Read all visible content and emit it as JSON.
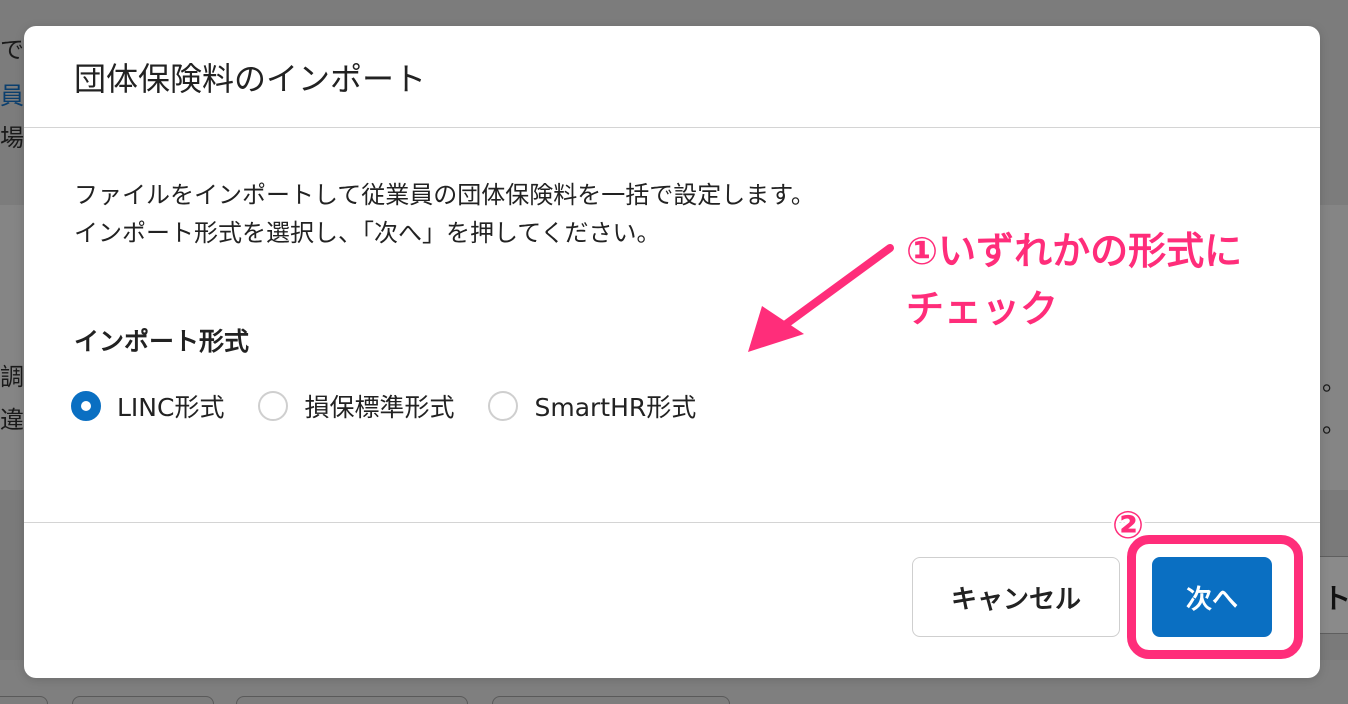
{
  "background": {
    "chars": [
      "で",
      "員",
      "場",
      "調",
      "違",
      "。",
      "。"
    ],
    "right_button_label": "ト"
  },
  "modal": {
    "title": "団体保険料のインポート",
    "description_line1": "ファイルをインポートして従業員の団体保険料を一括で設定します。",
    "description_line2": "インポート形式を選択し、「次へ」を押してください。",
    "section_label": "インポート形式",
    "radio_options": [
      {
        "label": "LINC形式",
        "checked": true
      },
      {
        "label": "損保標準形式",
        "checked": false
      },
      {
        "label": "SmartHR形式",
        "checked": false
      }
    ],
    "cancel_label": "キャンセル",
    "next_label": "次へ"
  },
  "annotations": {
    "step1_line1": "①いずれかの形式に",
    "step1_line2": "チェック",
    "step2": "②",
    "color": "#ff2d7a"
  },
  "colors": {
    "primary": "#0a6fc2",
    "annotation": "#ff2d7a"
  }
}
